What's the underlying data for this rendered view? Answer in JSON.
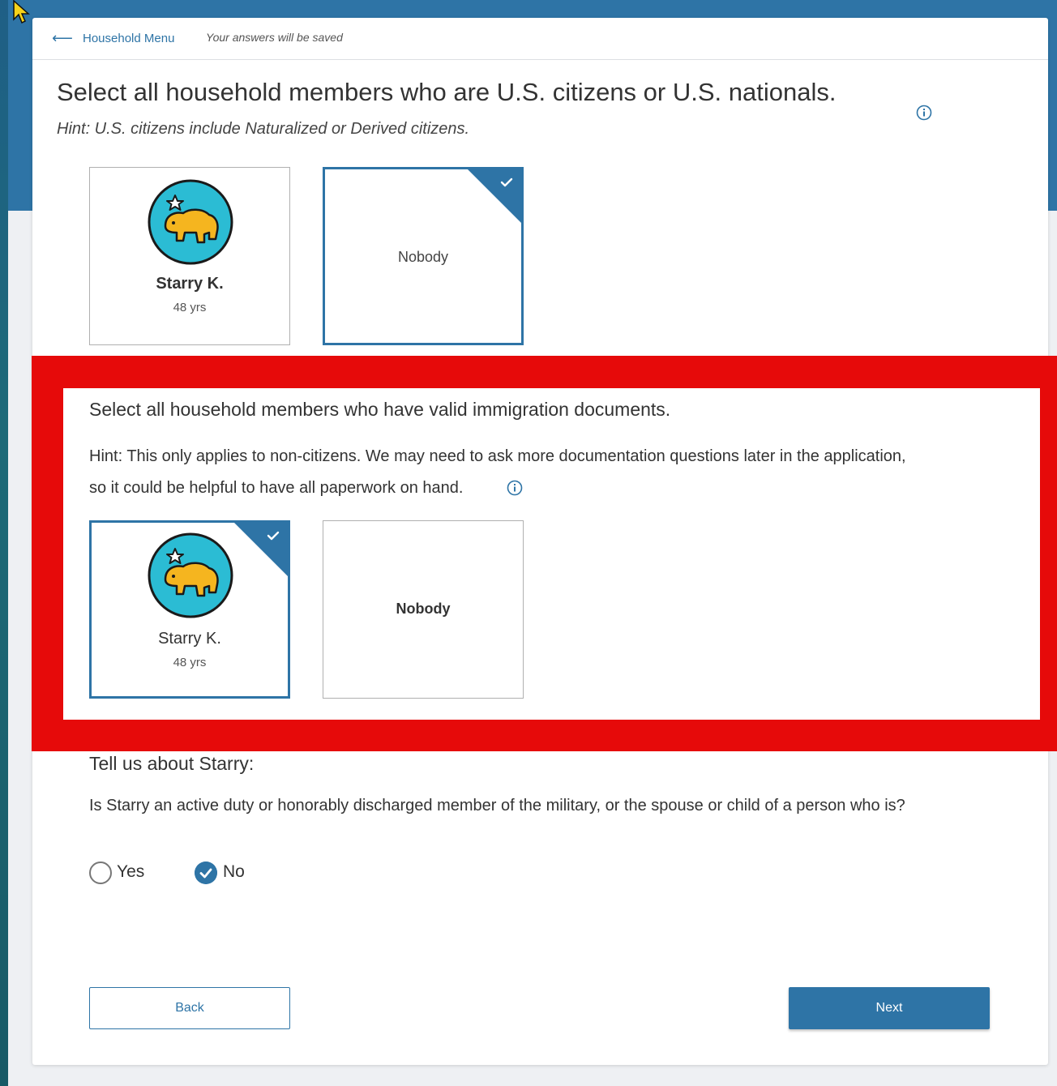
{
  "header": {
    "back_link": "Household Menu",
    "saved_note": "Your answers will be saved"
  },
  "citizens_question": {
    "title": "Select all household members who are U.S. citizens or U.S. nationals.",
    "hint": "Hint: U.S. citizens include Naturalized or Derived citizens.",
    "options": [
      {
        "name": "Starry K.",
        "age": "48 yrs",
        "selected": false
      },
      {
        "label": "Nobody",
        "selected": true
      }
    ]
  },
  "immigration_question": {
    "title": "Select all household members who have valid immigration documents.",
    "hint_line1": "Hint: This only applies to non-citizens. We may need to ask more documentation questions later in the application,",
    "hint_line2": "so it could be helpful to have all paperwork on hand.",
    "options": [
      {
        "name": "Starry K.",
        "age": "48 yrs",
        "selected": true
      },
      {
        "label": "Nobody",
        "selected": false
      }
    ]
  },
  "military_question": {
    "title": "Tell us about Starry:",
    "question": "Is Starry an active duty or honorably discharged member of the military, or the spouse or child of a person who is?",
    "options": [
      {
        "label": "Yes",
        "checked": false
      },
      {
        "label": "No",
        "checked": true
      }
    ]
  },
  "buttons": {
    "back": "Back",
    "next": "Next"
  },
  "colors": {
    "accent": "#2e74a6",
    "highlight": "#e60a0a",
    "avatar_bg": "#2bbcd4",
    "bear": "#f5b51f"
  },
  "icons": {
    "back": "arrow-left-icon",
    "info": "info-circle-icon",
    "check": "check-icon",
    "avatar": "bear-avatar-icon"
  }
}
